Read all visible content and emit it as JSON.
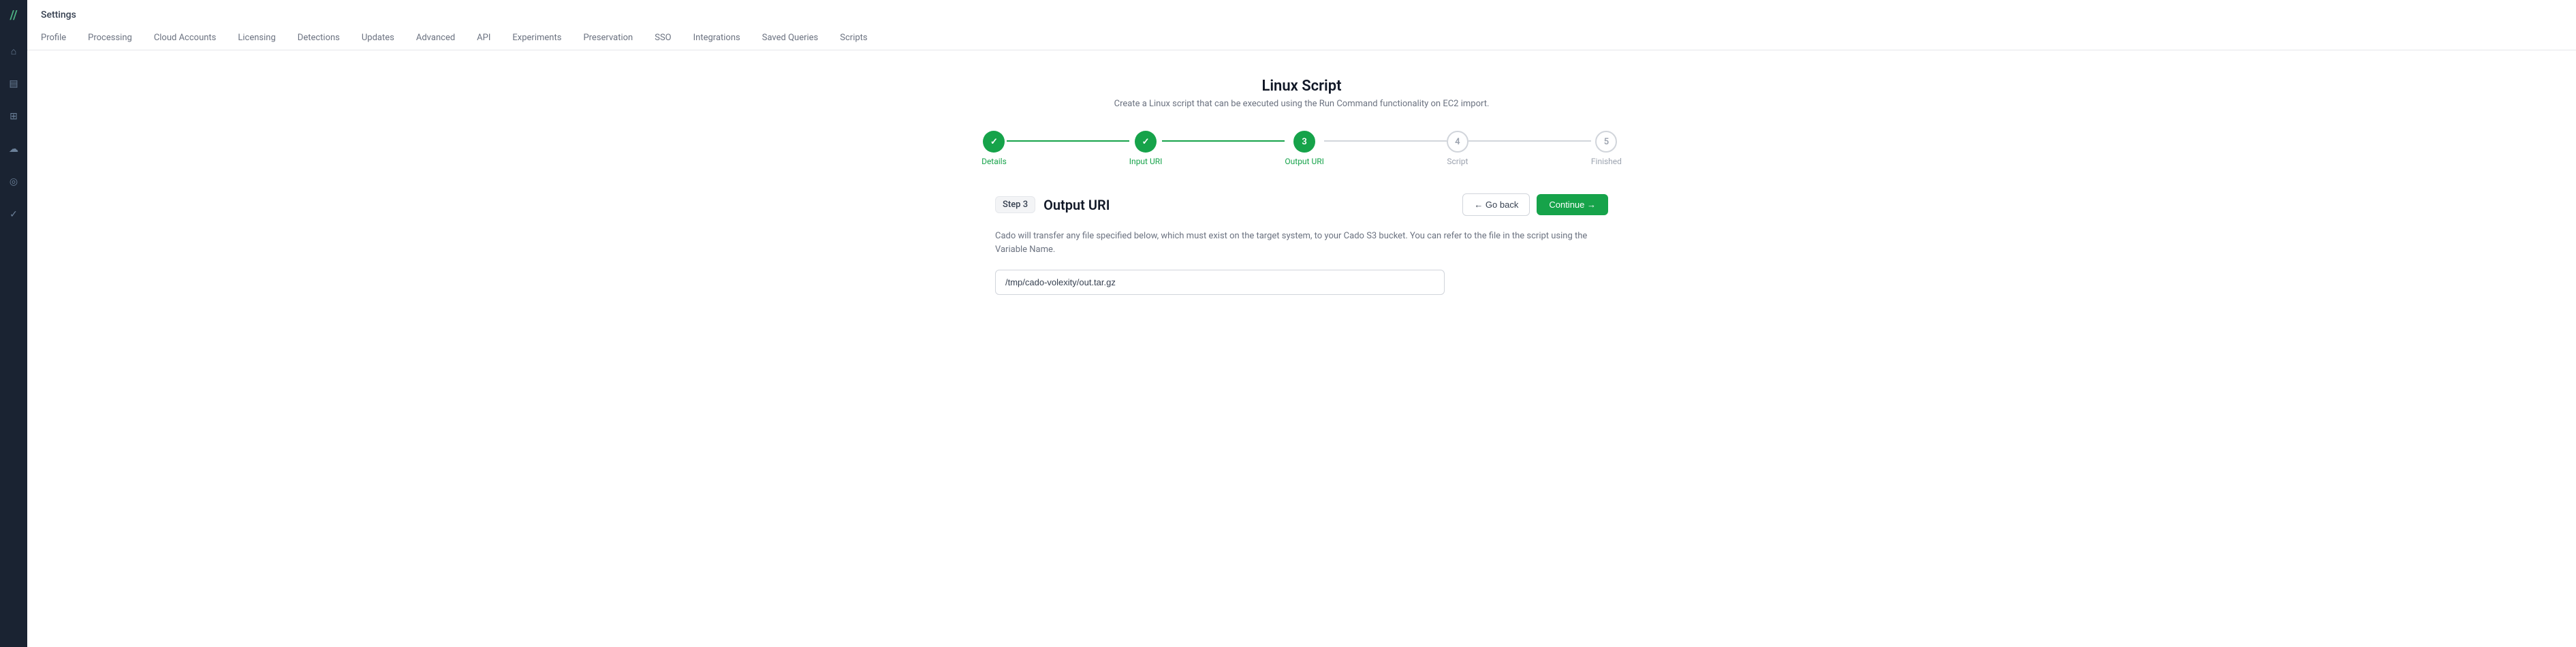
{
  "sidebar": {
    "logo": "//",
    "icons": [
      {
        "name": "home-icon",
        "symbol": "⌂",
        "active": false
      },
      {
        "name": "storage-icon",
        "symbol": "🗄",
        "active": false
      },
      {
        "name": "layers-icon",
        "symbol": "⊞",
        "active": false
      },
      {
        "name": "cloud-icon",
        "symbol": "☁",
        "active": false
      },
      {
        "name": "shield-icon",
        "symbol": "⊙",
        "active": false
      },
      {
        "name": "check-icon",
        "symbol": "✓",
        "active": false
      }
    ]
  },
  "page": {
    "title": "Settings"
  },
  "nav": {
    "tabs": [
      {
        "label": "Profile"
      },
      {
        "label": "Processing"
      },
      {
        "label": "Cloud Accounts"
      },
      {
        "label": "Licensing"
      },
      {
        "label": "Detections"
      },
      {
        "label": "Updates"
      },
      {
        "label": "Advanced"
      },
      {
        "label": "API"
      },
      {
        "label": "Experiments"
      },
      {
        "label": "Preservation"
      },
      {
        "label": "SSO"
      },
      {
        "label": "Integrations"
      },
      {
        "label": "Saved Queries"
      },
      {
        "label": "Scripts"
      }
    ]
  },
  "wizard": {
    "title": "Linux Script",
    "description": "Create a Linux script that can be executed using the Run Command functionality on EC2 import.",
    "steps": [
      {
        "number": "✓",
        "label": "Details",
        "state": "completed"
      },
      {
        "number": "✓",
        "label": "Input URI",
        "state": "completed"
      },
      {
        "number": "3",
        "label": "Output URI",
        "state": "active"
      },
      {
        "number": "4",
        "label": "Script",
        "state": "pending"
      },
      {
        "number": "5",
        "label": "Finished",
        "state": "pending"
      }
    ],
    "connectors": [
      {
        "state": "completed"
      },
      {
        "state": "completed"
      },
      {
        "state": "pending"
      },
      {
        "state": "pending"
      }
    ]
  },
  "step": {
    "badge": "Step 3",
    "title": "Output URI",
    "description": "Cado will transfer any file specified below, which must exist on the target system, to your Cado S3 bucket. You can refer to the file in the script using the Variable Name.",
    "uri_value": "/tmp/cado-volexity/out.tar.gz",
    "uri_placeholder": "/tmp/cado-volexity/out.tar.gz"
  },
  "buttons": {
    "back": "← Go back",
    "continue": "Continue →"
  }
}
